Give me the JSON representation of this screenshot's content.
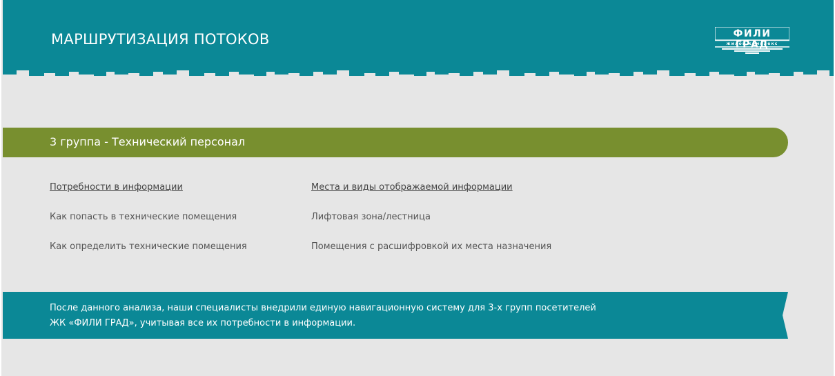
{
  "header": {
    "title": "МАРШРУТИЗАЦИЯ ПОТОКОВ",
    "logo": {
      "name": "ФИЛИ ГРАД",
      "subtitle": "жилой комплекс"
    }
  },
  "group": {
    "number": "3 группа",
    "separator": " - ",
    "name": "Технический персонал"
  },
  "table": {
    "headers": [
      "Потребности в информации",
      "Места и виды отображаемой информации"
    ],
    "rows": [
      [
        "Как попасть в технические помещения",
        "Лифтовая зона/лестница"
      ],
      [
        "Как определить технические помещения",
        "Помещения с расшифровкой их места назначения"
      ]
    ]
  },
  "footer": {
    "line1": "После данного анализа, наши специалисты внедрили единую навигационную систему для 3-х групп посетителей",
    "line2": "ЖК «ФИЛИ ГРАД», учитывая все их потребности в информации."
  },
  "colors": {
    "teal": "#0b8896",
    "olive": "#788f2f",
    "background": "#e6e6e6",
    "text": "#555555"
  }
}
